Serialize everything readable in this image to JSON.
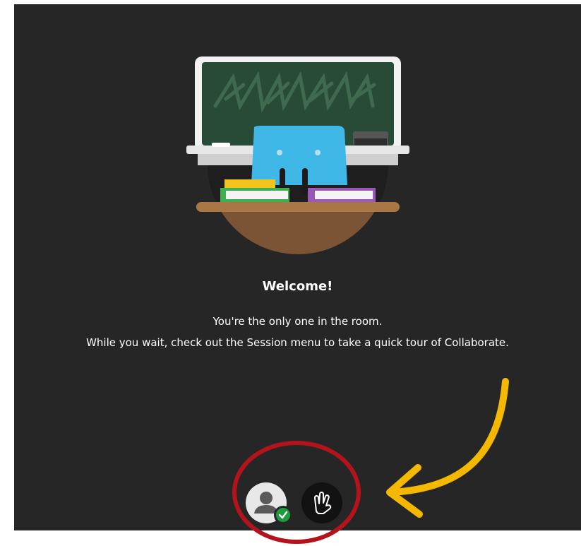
{
  "welcome": {
    "title": "Welcome!",
    "line1": "You're the only one in the room.",
    "line2": "While you wait, check out the Session menu to take a quick tour of Collaborate."
  },
  "icons": {
    "avatar": "user-avatar-icon",
    "status": "check-icon",
    "raise_hand": "raise-hand-icon"
  },
  "colors": {
    "background": "#262626",
    "highlight_circle": "#b3141b",
    "arrow": "#f5b800",
    "status_green": "#1e9c3c",
    "chalkboard": "#274b37"
  }
}
